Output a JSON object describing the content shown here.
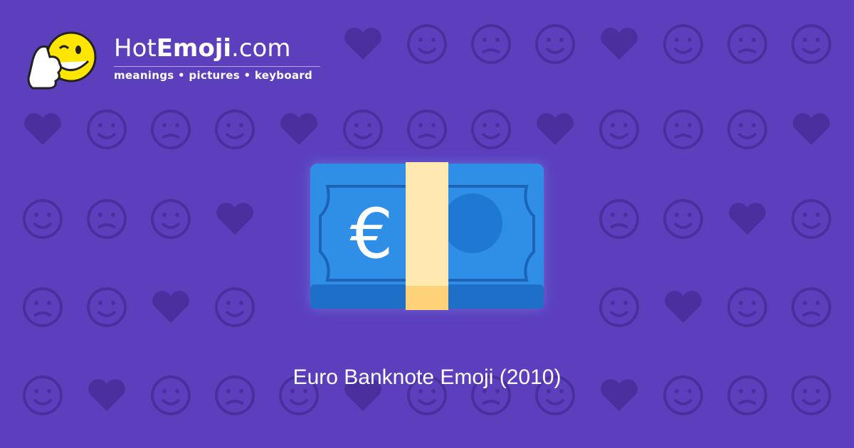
{
  "brand": {
    "name_part1": "Hot",
    "name_part2": "Emoji",
    "name_part3": ".com",
    "tagline": "meanings • pictures • keyboard"
  },
  "emoji": {
    "symbol": "€",
    "icon": "euro-banknote-icon"
  },
  "caption": "Euro Banknote Emoji (2010)",
  "colors": {
    "background": "#5b3fbd",
    "pattern": "#4a2f9f",
    "banknote": "#2f8fe6",
    "band": "#ffe9b0",
    "logo_face": "#ffe600"
  }
}
